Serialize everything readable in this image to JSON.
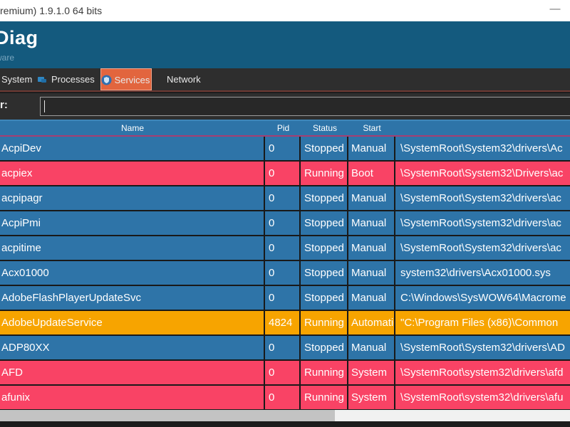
{
  "window": {
    "title": "remium) 1.9.1.0 64 bits",
    "minimize": "—"
  },
  "header": {
    "app_title": "Diag",
    "subtitle": "ware"
  },
  "tabs": {
    "system": "System",
    "processes": "Processes",
    "services": "Services",
    "network": "Network",
    "active": "Services"
  },
  "filter": {
    "label": "r:",
    "value": ""
  },
  "table": {
    "columns": {
      "name": "Name",
      "pid": "Pid",
      "status": "Status",
      "start": "Start",
      "path": ""
    },
    "rows": [
      {
        "name": "AcpiDev",
        "pid": "0",
        "status": "Stopped",
        "start": "Manual",
        "path": "\\SystemRoot\\System32\\drivers\\Ac",
        "variant": "blue"
      },
      {
        "name": "acpiex",
        "pid": "0",
        "status": "Running",
        "start": "Boot",
        "path": "\\SystemRoot\\System32\\Drivers\\ac",
        "variant": "pink"
      },
      {
        "name": "acpipagr",
        "pid": "0",
        "status": "Stopped",
        "start": "Manual",
        "path": "\\SystemRoot\\System32\\drivers\\ac",
        "variant": "blue"
      },
      {
        "name": "AcpiPmi",
        "pid": "0",
        "status": "Stopped",
        "start": "Manual",
        "path": "\\SystemRoot\\System32\\drivers\\ac",
        "variant": "blue"
      },
      {
        "name": "acpitime",
        "pid": "0",
        "status": "Stopped",
        "start": "Manual",
        "path": "\\SystemRoot\\System32\\drivers\\ac",
        "variant": "blue"
      },
      {
        "name": "Acx01000",
        "pid": "0",
        "status": "Stopped",
        "start": "Manual",
        "path": "system32\\drivers\\Acx01000.sys",
        "variant": "blue"
      },
      {
        "name": "AdobeFlashPlayerUpdateSvc",
        "pid": "0",
        "status": "Stopped",
        "start": "Manual",
        "path": "C:\\Windows\\SysWOW64\\Macrome",
        "variant": "blue"
      },
      {
        "name": "AdobeUpdateService",
        "pid": "4824",
        "status": "Running",
        "start": "Automatic",
        "path": "\"C:\\Program Files (x86)\\Common",
        "variant": "orange"
      },
      {
        "name": "ADP80XX",
        "pid": "0",
        "status": "Stopped",
        "start": "Manual",
        "path": "\\SystemRoot\\System32\\drivers\\AD",
        "variant": "blue"
      },
      {
        "name": "AFD",
        "pid": "0",
        "status": "Running",
        "start": "System",
        "path": "\\SystemRoot\\system32\\drivers\\afd",
        "variant": "pink"
      },
      {
        "name": "afunix",
        "pid": "0",
        "status": "Running",
        "start": "System",
        "path": "\\SystemRoot\\system32\\drivers\\afu",
        "variant": "pink"
      }
    ]
  },
  "colors": {
    "row_blue": "#2e74a8",
    "row_pink": "#f94365",
    "row_orange": "#f7a400",
    "header_band": "#145a7e",
    "tab_active": "#e2653e",
    "tab_underline": "#6e3a33",
    "header_divider_pink": "#a63e72",
    "table_top_line": "#3e86ba"
  }
}
